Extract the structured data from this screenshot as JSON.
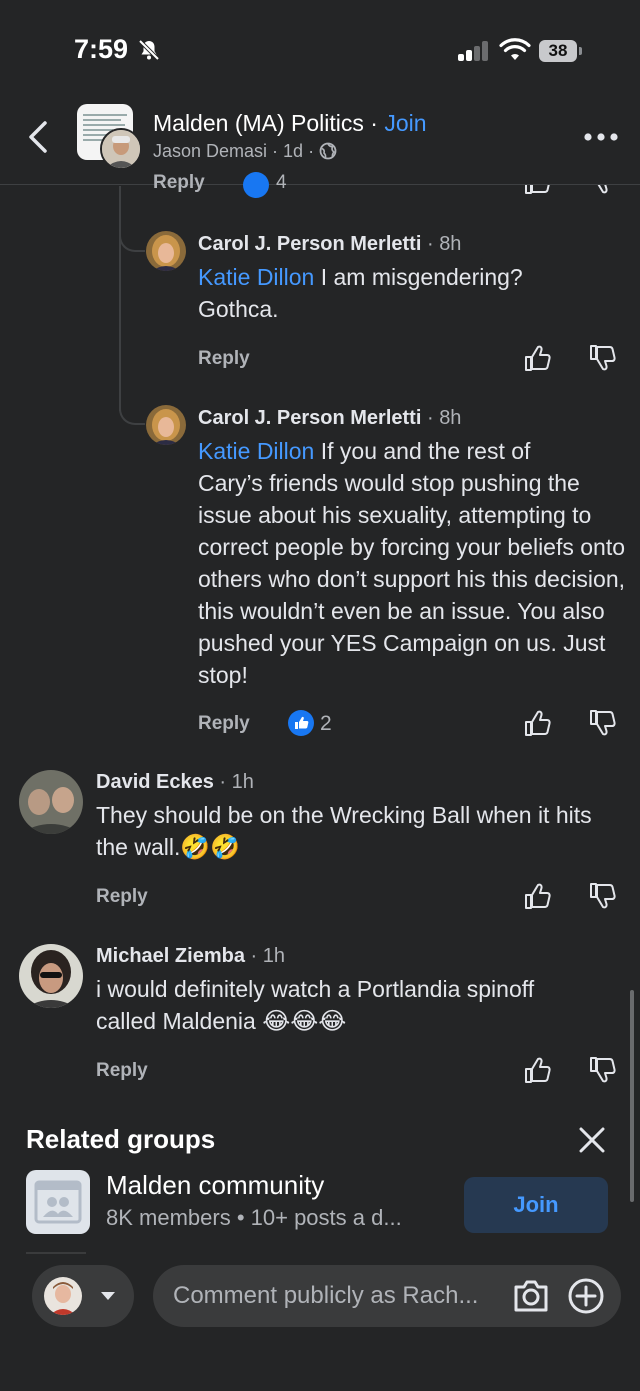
{
  "status_bar": {
    "time": "7:59",
    "battery": "38"
  },
  "header": {
    "group_name": "Malden (MA) Politics",
    "separator": " · ",
    "join_label": "Join",
    "poster": "Jason Demasi",
    "age": "1d"
  },
  "partial_comment": {
    "reply_label": "Reply",
    "like_count": "4"
  },
  "comments": [
    {
      "author": "Carol J. Person Merletti",
      "time": "8h",
      "mention": "Katie Dillon",
      "text_line1": " I am misgendering?",
      "text_rest": "Gothca.",
      "reply_label": "Reply"
    },
    {
      "author": "Carol J. Person Merletti",
      "time": "8h",
      "mention": "Katie Dillon",
      "text_line1": " If you and the rest of",
      "text_rest": "Cary’s friends would stop pushing the issue about his sexuality, attempting to correct people by forcing your beliefs onto others who don’t support his this decision, this wouldn’t even be an issue. You also pushed your YES Campaign on us. Just stop!",
      "reply_label": "Reply",
      "like_count": "2"
    },
    {
      "author": "David Eckes",
      "time": "1h",
      "text": "They should be on the Wrecking Ball when it hits the wall.",
      "emojis": "🤣🤣",
      "reply_label": "Reply"
    },
    {
      "author": "Michael Ziemba",
      "time": "1h",
      "text": "i would definitely watch a Portlandia spinoff called Maldenia ",
      "emojis": "😂😂😂",
      "reply_label": "Reply"
    }
  ],
  "related_groups": {
    "title": "Related groups",
    "group": {
      "name": "Malden community",
      "meta": "8K members • 10+ posts a d...",
      "join_label": "Join"
    }
  },
  "composer": {
    "placeholder": "Comment publicly as Rach..."
  },
  "colors": {
    "background": "#242526",
    "accent": "#4599ff",
    "like_blue": "#1877f2",
    "muted": "#b0b3b8"
  },
  "icons": [
    "bell-slash-icon",
    "signal-icon",
    "wifi-icon",
    "battery-icon",
    "back-arrow-icon",
    "globe-icon",
    "more-icon",
    "thumbs-up-icon",
    "thumbs-down-icon",
    "like-badge-icon",
    "close-icon",
    "group-icon",
    "chevron-down-icon",
    "camera-icon",
    "plus-circle-icon"
  ]
}
